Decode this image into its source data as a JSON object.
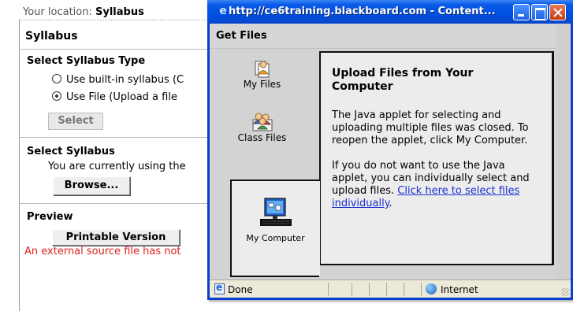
{
  "background_page": {
    "location_label": "Your location:",
    "location_value": "Syllabus",
    "title": "Syllabus",
    "select_type_heading": "Select Syllabus Type",
    "radio_builtin_label": "Use built-in syllabus  (C",
    "radio_file_label": "Use File  (Upload a file",
    "select_button": "Select",
    "select_syllabus_heading": "Select Syllabus",
    "current_note": "You are currently using the",
    "browse_button": "Browse...",
    "preview_heading": "Preview",
    "printable_button": "Printable Version",
    "error_text": "An external source file has not"
  },
  "popup": {
    "window_title": "http://ce6training.blackboard.com - Content...",
    "header": "Get Files",
    "tabs": [
      {
        "label": "My Files",
        "icon": "my-files-icon"
      },
      {
        "label": "Class Files",
        "icon": "class-files-icon"
      },
      {
        "label": "My Computer",
        "icon": "my-computer-icon"
      }
    ],
    "panel_heading": "Upload Files from Your Computer",
    "panel_para1": "The Java applet for selecting and uploading multiple files was closed. To reopen the applet, click My Computer.",
    "panel_para2_text": "If you do not want to use the Java applet, you can individually select and upload files.",
    "panel_link": "Click here to select files individually",
    "panel_para2_end": "."
  },
  "statusbar": {
    "status": "Done",
    "zone": "Internet"
  },
  "colors": {
    "titlebar_blue": "#0050e0",
    "error_red": "#e02020",
    "link_blue": "#1a2fd0"
  }
}
